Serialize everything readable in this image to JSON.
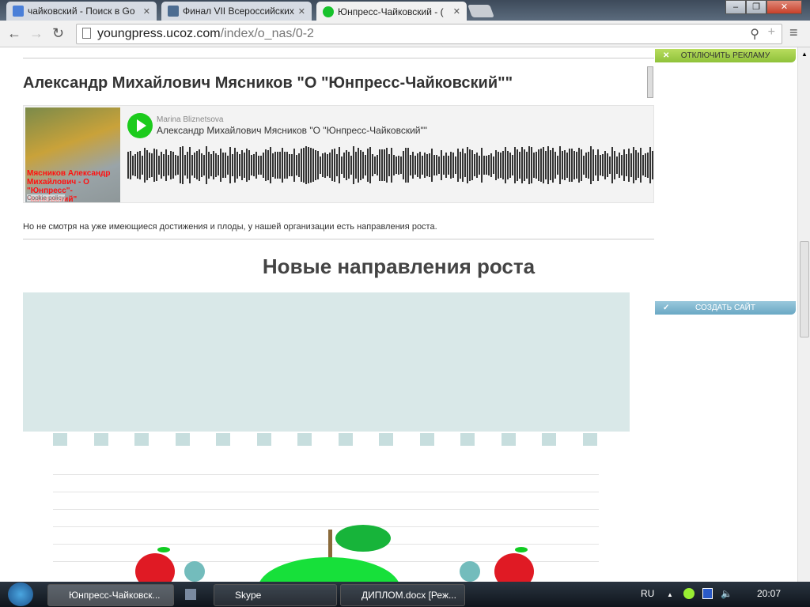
{
  "browser": {
    "tabs": [
      {
        "label": "чайковский - Поиск в Go",
        "icon": "google-icon",
        "color": "#4a7fd8"
      },
      {
        "label": "Финал VII Всероссийских",
        "icon": "vk-icon",
        "color": "#4c6c91"
      },
      {
        "label": "Юнпресс-Чайковский - (",
        "icon": "apple-icon",
        "color": "#17c22b"
      }
    ],
    "url_host": "youngpress.ucoz.com",
    "url_path": "/index/o_nas/0-2"
  },
  "page": {
    "title": "Александр Михайлович Мясников \"О \"Юнпресс-Чайковский\"\"",
    "player": {
      "artist": "Marina Bliznetsova",
      "track": "Александр Михайлович Мясников \"О \"Юнпресс-Чайковский\"\"",
      "photo_caption": "Мясников Александр Михайлович - О \"Юнпресс\"-Чайковский\"",
      "cookie": "Cookie policy"
    },
    "paragraph": "Но не смотря на уже имеющиеся достижения и плоды, у нашей организации есть направления роста.",
    "heading": "Новые направления роста"
  },
  "ads": {
    "disable": "ОТКЛЮЧИТЬ РЕКЛАМУ",
    "create": "СОЗДАТЬ САЙТ",
    "small_label": "x-close"
  },
  "taskbar": {
    "items": [
      "Юнпресс-Чайковск...",
      "Skype",
      "ДИПЛОМ.docx [Реж..."
    ],
    "lang": "RU",
    "time": "20:07"
  }
}
